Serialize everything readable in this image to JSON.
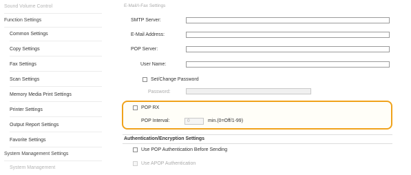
{
  "sidebar": {
    "items": [
      {
        "label": "Sound Volume Control"
      },
      {
        "label": "Function Settings"
      },
      {
        "label": "Common Settings"
      },
      {
        "label": "Copy Settings"
      },
      {
        "label": "Fax Settings"
      },
      {
        "label": "Scan Settings"
      },
      {
        "label": "Memory Media Print Settings"
      },
      {
        "label": "Printer Settings"
      },
      {
        "label": "Output Report Settings"
      },
      {
        "label": "Favorite Settings"
      },
      {
        "label": "System Management Settings"
      },
      {
        "label": "System Management"
      }
    ]
  },
  "email_fax": {
    "title": "E-Mail/I-Fax Settings",
    "smtp_label": "SMTP Server:",
    "smtp_value": "",
    "email_label": "E-Mail Address:",
    "email_value": "",
    "pop_server_label": "POP Server:",
    "pop_server_value": "",
    "username_label": "User Name:",
    "username_value": "",
    "set_password_label": "Set/Change Password",
    "password_label": "Password:",
    "password_value": "",
    "pop_rx_label": "POP RX",
    "pop_interval_label": "POP Interval:",
    "pop_interval_value": "0",
    "pop_interval_hint": "min.(0=Off/1-99)"
  },
  "auth": {
    "title": "Authentication/Encryption Settings",
    "use_pop_auth_label": "Use POP Authentication Before Sending",
    "use_apop_label": "Use APOP Authentication"
  },
  "colors": {
    "highlight": "#f0a21a"
  }
}
